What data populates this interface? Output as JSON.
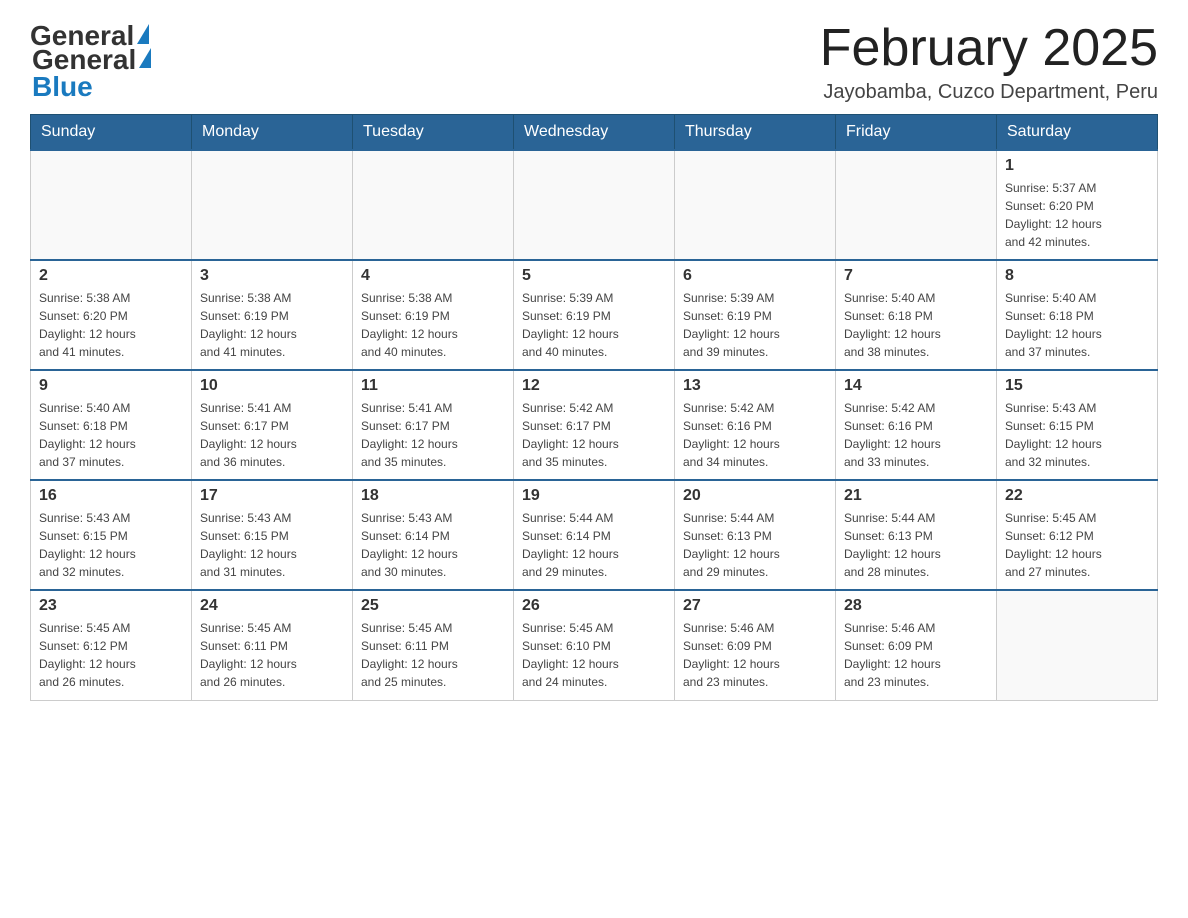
{
  "header": {
    "logo_general": "General",
    "logo_blue": "Blue",
    "title": "February 2025",
    "location": "Jayobamba, Cuzco Department, Peru"
  },
  "weekdays": [
    "Sunday",
    "Monday",
    "Tuesday",
    "Wednesday",
    "Thursday",
    "Friday",
    "Saturday"
  ],
  "weeks": [
    [
      {
        "day": "",
        "info": ""
      },
      {
        "day": "",
        "info": ""
      },
      {
        "day": "",
        "info": ""
      },
      {
        "day": "",
        "info": ""
      },
      {
        "day": "",
        "info": ""
      },
      {
        "day": "",
        "info": ""
      },
      {
        "day": "1",
        "info": "Sunrise: 5:37 AM\nSunset: 6:20 PM\nDaylight: 12 hours\nand 42 minutes."
      }
    ],
    [
      {
        "day": "2",
        "info": "Sunrise: 5:38 AM\nSunset: 6:20 PM\nDaylight: 12 hours\nand 41 minutes."
      },
      {
        "day": "3",
        "info": "Sunrise: 5:38 AM\nSunset: 6:19 PM\nDaylight: 12 hours\nand 41 minutes."
      },
      {
        "day": "4",
        "info": "Sunrise: 5:38 AM\nSunset: 6:19 PM\nDaylight: 12 hours\nand 40 minutes."
      },
      {
        "day": "5",
        "info": "Sunrise: 5:39 AM\nSunset: 6:19 PM\nDaylight: 12 hours\nand 40 minutes."
      },
      {
        "day": "6",
        "info": "Sunrise: 5:39 AM\nSunset: 6:19 PM\nDaylight: 12 hours\nand 39 minutes."
      },
      {
        "day": "7",
        "info": "Sunrise: 5:40 AM\nSunset: 6:18 PM\nDaylight: 12 hours\nand 38 minutes."
      },
      {
        "day": "8",
        "info": "Sunrise: 5:40 AM\nSunset: 6:18 PM\nDaylight: 12 hours\nand 37 minutes."
      }
    ],
    [
      {
        "day": "9",
        "info": "Sunrise: 5:40 AM\nSunset: 6:18 PM\nDaylight: 12 hours\nand 37 minutes."
      },
      {
        "day": "10",
        "info": "Sunrise: 5:41 AM\nSunset: 6:17 PM\nDaylight: 12 hours\nand 36 minutes."
      },
      {
        "day": "11",
        "info": "Sunrise: 5:41 AM\nSunset: 6:17 PM\nDaylight: 12 hours\nand 35 minutes."
      },
      {
        "day": "12",
        "info": "Sunrise: 5:42 AM\nSunset: 6:17 PM\nDaylight: 12 hours\nand 35 minutes."
      },
      {
        "day": "13",
        "info": "Sunrise: 5:42 AM\nSunset: 6:16 PM\nDaylight: 12 hours\nand 34 minutes."
      },
      {
        "day": "14",
        "info": "Sunrise: 5:42 AM\nSunset: 6:16 PM\nDaylight: 12 hours\nand 33 minutes."
      },
      {
        "day": "15",
        "info": "Sunrise: 5:43 AM\nSunset: 6:15 PM\nDaylight: 12 hours\nand 32 minutes."
      }
    ],
    [
      {
        "day": "16",
        "info": "Sunrise: 5:43 AM\nSunset: 6:15 PM\nDaylight: 12 hours\nand 32 minutes."
      },
      {
        "day": "17",
        "info": "Sunrise: 5:43 AM\nSunset: 6:15 PM\nDaylight: 12 hours\nand 31 minutes."
      },
      {
        "day": "18",
        "info": "Sunrise: 5:43 AM\nSunset: 6:14 PM\nDaylight: 12 hours\nand 30 minutes."
      },
      {
        "day": "19",
        "info": "Sunrise: 5:44 AM\nSunset: 6:14 PM\nDaylight: 12 hours\nand 29 minutes."
      },
      {
        "day": "20",
        "info": "Sunrise: 5:44 AM\nSunset: 6:13 PM\nDaylight: 12 hours\nand 29 minutes."
      },
      {
        "day": "21",
        "info": "Sunrise: 5:44 AM\nSunset: 6:13 PM\nDaylight: 12 hours\nand 28 minutes."
      },
      {
        "day": "22",
        "info": "Sunrise: 5:45 AM\nSunset: 6:12 PM\nDaylight: 12 hours\nand 27 minutes."
      }
    ],
    [
      {
        "day": "23",
        "info": "Sunrise: 5:45 AM\nSunset: 6:12 PM\nDaylight: 12 hours\nand 26 minutes."
      },
      {
        "day": "24",
        "info": "Sunrise: 5:45 AM\nSunset: 6:11 PM\nDaylight: 12 hours\nand 26 minutes."
      },
      {
        "day": "25",
        "info": "Sunrise: 5:45 AM\nSunset: 6:11 PM\nDaylight: 12 hours\nand 25 minutes."
      },
      {
        "day": "26",
        "info": "Sunrise: 5:45 AM\nSunset: 6:10 PM\nDaylight: 12 hours\nand 24 minutes."
      },
      {
        "day": "27",
        "info": "Sunrise: 5:46 AM\nSunset: 6:09 PM\nDaylight: 12 hours\nand 23 minutes."
      },
      {
        "day": "28",
        "info": "Sunrise: 5:46 AM\nSunset: 6:09 PM\nDaylight: 12 hours\nand 23 minutes."
      },
      {
        "day": "",
        "info": ""
      }
    ]
  ]
}
